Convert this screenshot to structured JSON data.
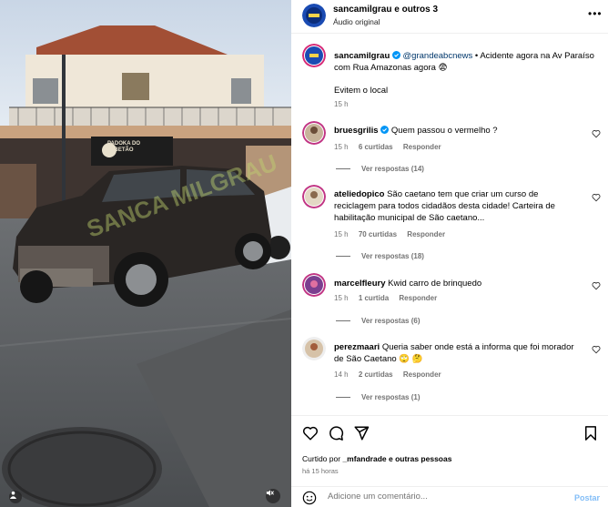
{
  "header": {
    "title": "sancamilgrau e outros 3",
    "subtitle": "Áudio original",
    "more_label": "•••"
  },
  "caption": {
    "username": "sancamilgrau",
    "mention": "@grandeabcnews",
    "text": "• Acidente agora na Av Paraíso com Rua Amazonas agora 😨",
    "line2": "Evitem o local",
    "time": "15 h"
  },
  "comments": [
    {
      "username": "bruesgrilis",
      "text": "Quem passou o vermelho ?",
      "time": "15 h",
      "likes": "6 curtidas",
      "reply": "Responder",
      "view_replies": "Ver respostas (14)"
    },
    {
      "username": "ateliedopico",
      "text": "São caetano tem que criar um curso de reciclagem para todos cidadãos desta cidade! Carteira de habilitação municipal de São caetano...",
      "time": "15 h",
      "likes": "70 curtidas",
      "reply": "Responder",
      "view_replies": "Ver respostas (18)"
    },
    {
      "username": "marcelfleury",
      "text": "Kwid carro de brinquedo",
      "time": "15 h",
      "likes": "1 curtida",
      "reply": "Responder",
      "view_replies": "Ver respostas (6)"
    },
    {
      "username": "perezmaari",
      "text": "Queria saber onde está a informa que foi morador de São Caetano 🙄 🤔",
      "time": "14 h",
      "likes": "2 curtidas",
      "reply": "Responder",
      "view_replies": "Ver respostas (1)"
    }
  ],
  "liked_by": {
    "prefix": "Curtido por",
    "user": "_mfandrade",
    "suffix": "e outras pessoas"
  },
  "time_ago": "há 15 horas",
  "comment_box": {
    "placeholder": "Adicione um comentário...",
    "post_label": "Postar"
  },
  "media": {
    "sign_text": "PADOKA DO BETÃO",
    "watermark": "SANCA MILGRAU"
  },
  "icons": [
    "heart-icon",
    "comment-icon",
    "share-icon",
    "bookmark-icon",
    "emoji-icon",
    "mute-icon",
    "verified-icon",
    "more-icon"
  ],
  "colors": {
    "verified": "#0095f6",
    "link": "#00376b",
    "post_disabled": "#82bdf7",
    "muted": "#737373"
  }
}
